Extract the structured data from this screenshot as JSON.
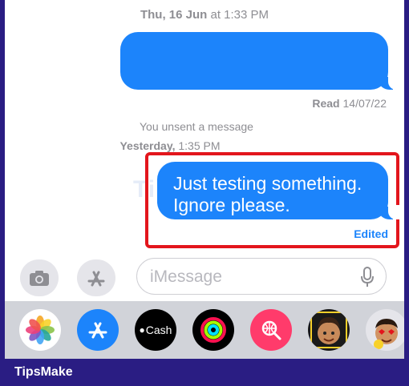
{
  "timestamps": {
    "top_day": "Thu, 16 Jun",
    "top_time": "at 1:33 PM",
    "middle_day": "Yesterday,",
    "middle_time": "1:35 PM"
  },
  "receipt": {
    "bold": "Read",
    "date": "14/07/22"
  },
  "unsent_notice": "You unsent a message",
  "message": {
    "line1": "Just testing something.",
    "line2": "Ignore please.",
    "edited_label": "Edited"
  },
  "input": {
    "placeholder": "iMessage"
  },
  "apps": [
    {
      "name": "photos-app",
      "label": ""
    },
    {
      "name": "app-store-app",
      "label": ""
    },
    {
      "name": "apple-cash-app",
      "label": "Cash"
    },
    {
      "name": "activity-app",
      "label": ""
    },
    {
      "name": "web-search-app",
      "label": ""
    },
    {
      "name": "memoji-app",
      "label": ""
    },
    {
      "name": "memoji-stickers-app",
      "label": ""
    }
  ],
  "watermark": "TipsMake",
  "footer": {
    "brand": "TipsMake"
  },
  "colors": {
    "bubble": "#1c84fb",
    "highlight": "#e3151c",
    "frame": "#2a1d83",
    "tray": "#d1d3d9"
  }
}
